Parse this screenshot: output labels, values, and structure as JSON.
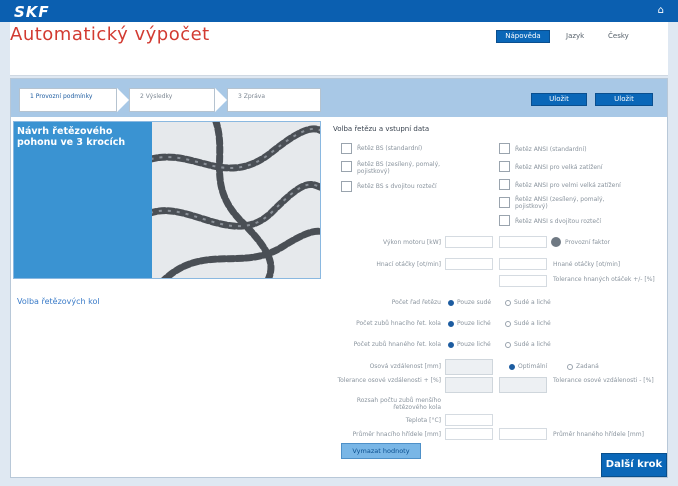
{
  "brand": {
    "logo": "SKF",
    "home_icon": "home-icon"
  },
  "header": {
    "title": "Automatický výpočet",
    "help": "Nápověda",
    "lang_1": "Jazyk",
    "lang_2": "Česky"
  },
  "steps": [
    {
      "label": "1 Provozní podmínky"
    },
    {
      "label": "2 Výsledky"
    },
    {
      "label": "3 Zpráva"
    }
  ],
  "toolbar": {
    "print": "Uložit",
    "save": "Uložit"
  },
  "promo": {
    "title": "Návrh řetězového pohonu ve 3 krocích"
  },
  "left_link": "Volba řetězových kol",
  "form": {
    "section_title": "Volba řetězu a vstupní data",
    "chain_options_left": [
      "Řetěz BS (standardní)",
      "Řetěz BS (zesílený, pomalý, pojistkový)",
      "Řetěz BS s dvojitou roztečí"
    ],
    "chain_options_right": [
      "Řetěz ANSI (standardní)",
      "Řetěz ANSI pro velká zatížení",
      "Řetěz ANSI pro velmi velká zatížení",
      "Řetěz ANSI (zesílený, pomalý, pojistkový)",
      "Řetěz ANSI s dvojitou roztečí"
    ],
    "power_label": "Výkon motoru [kW]",
    "service_factor": "Provozní faktor",
    "drive_speed_label": "Hnací otáčky [ot/min]",
    "driven_speed_label": "Hnané otáčky [ot/min]",
    "tolerance_label": "Tolerance hnaných otáček +/- [%]",
    "strands_label": "Počet řad řetězu",
    "strands_opt1": "Pouze sudé",
    "strands_opt2": "Sudé a liché",
    "teeth_drive_label": "Počet zubů hnacího řet. kola",
    "teeth_drive_opt1": "Pouze liché",
    "teeth_drive_opt2": "Sudé a liché",
    "teeth_driven_label": "Počet zubů hnaného řet. kola",
    "teeth_driven_opt1": "Pouze liché",
    "teeth_driven_opt2": "Sudé a liché",
    "center_label": "Osová vzdálenost [mm]",
    "center_opt1": "Optimální",
    "center_opt2": "Zadaná",
    "center_tol_label": "Tolerance osové vzdálenosti + [%]",
    "center_tol_right": "Tolerance osové vzdálenosti - [%]",
    "min_teeth_label": "Rozsah počtu zubů menšího řetězového kola",
    "temp_label": "Teplota [°C]",
    "drive_shaft_label": "Průměr hnacího hřídele [mm]",
    "driven_shaft_label": "Průměr hnaného hřídele [mm]",
    "calc_button": "Vymazat hodnoty",
    "next_button": "Další krok"
  }
}
